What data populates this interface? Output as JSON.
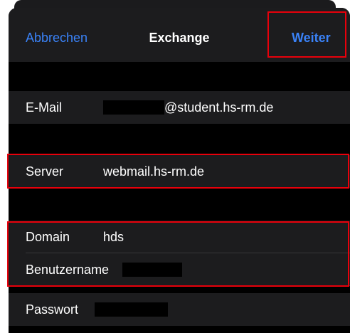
{
  "navbar": {
    "cancel_label": "Abbrechen",
    "title": "Exchange",
    "next_label": "Weiter"
  },
  "form": {
    "email": {
      "label": "E-Mail",
      "value_suffix": "@student.hs-rm.de"
    },
    "server": {
      "label": "Server",
      "value": "webmail.hs-rm.de"
    },
    "domain": {
      "label": "Domain",
      "value": "hds"
    },
    "username": {
      "label": "Benutzername"
    },
    "password": {
      "label": "Passwort"
    }
  },
  "colors": {
    "accent": "#3a82f7",
    "sheet_background": "#000000",
    "cell_background": "#1c1c1e",
    "highlight": "#e8000b",
    "text": "#ffffff"
  }
}
